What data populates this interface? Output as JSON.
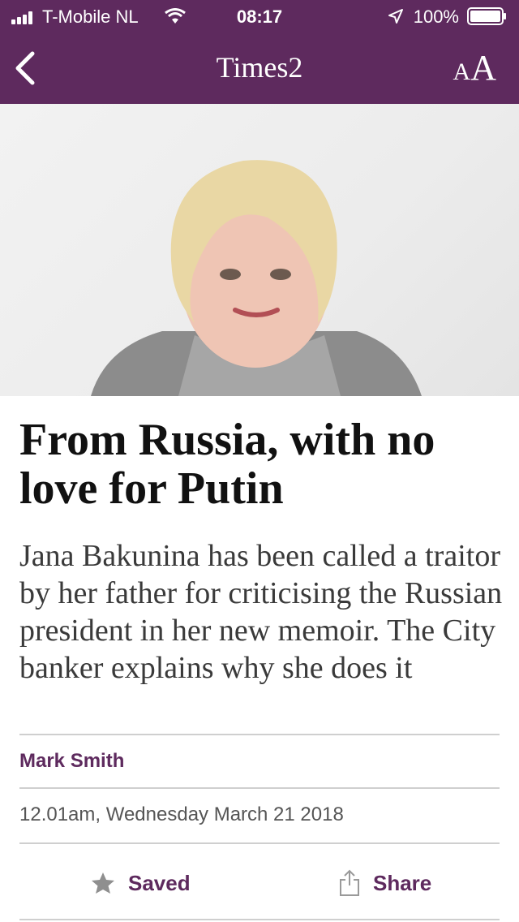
{
  "status_bar": {
    "carrier": "T-Mobile NL",
    "time": "08:17",
    "battery_percent": "100%",
    "icons": [
      "signal-icon",
      "wifi-icon",
      "location-icon",
      "battery-icon"
    ]
  },
  "nav": {
    "title": "Times2",
    "font_size_label_small": "A",
    "font_size_label_large": "A",
    "back_icon": "chevron-left-icon"
  },
  "article": {
    "headline": "From Russia, with no love for Putin",
    "standfirst": "Jana Bakunina has been called a traitor by her father for criticising the Russian president in her new memoir. The City banker explains why she does it",
    "author": "Mark Smith",
    "timestamp": "12.01am, Wednesday March 21 2018"
  },
  "actions": {
    "save_label": "Saved",
    "share_label": "Share"
  },
  "colors": {
    "brand": "#5e2a5e",
    "text": "#111111",
    "subtext": "#3a3a3a",
    "divider": "#cfcfcf"
  }
}
